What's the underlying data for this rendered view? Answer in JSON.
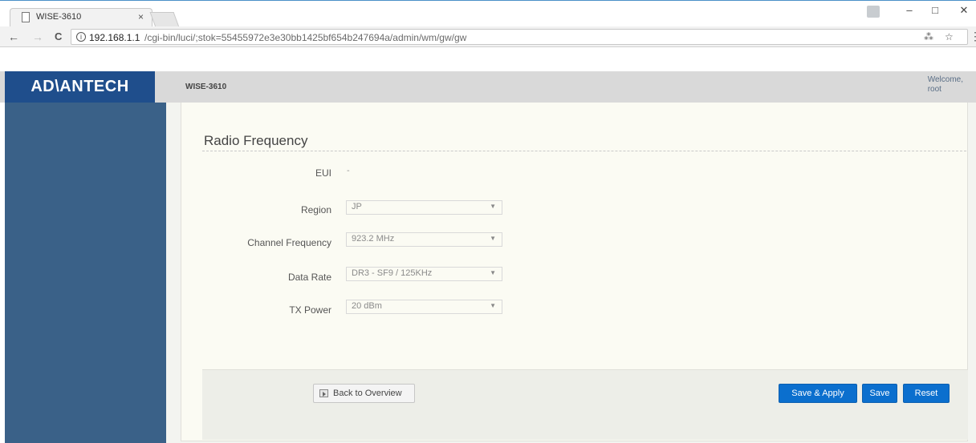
{
  "browser": {
    "tab_title": "WISE-3610",
    "tab_close": "×",
    "url_host": "192.168.1.1",
    "url_path": "/cgi-bin/luci/;stok=55455972e3e30bb1425bf654b247694a/admin/wm/gw/gw",
    "window_controls": {
      "minimize": "–",
      "maximize": "□",
      "close": "✕"
    },
    "nav": {
      "back": "←",
      "forward": "→",
      "reload": "C",
      "info": "i",
      "translate": "⁂",
      "bookmark": "☆",
      "menu": "⋮"
    }
  },
  "header": {
    "logo": "AD\\ANTECH",
    "hostname": "WISE-3610",
    "welcome": "Welcome,",
    "user": "root"
  },
  "colors": {
    "brand": "#1f4e8c",
    "sidebar": "#3a6188",
    "primary_button": "#0b6fce"
  },
  "form": {
    "title": "Radio Frequency",
    "eui": {
      "label": "EUI",
      "value": "-"
    },
    "region": {
      "label": "Region",
      "value": "JP"
    },
    "channel_frequency": {
      "label": "Channel Frequency",
      "value": "923.2 MHz"
    },
    "data_rate": {
      "label": "Data Rate",
      "value": "DR3 - SF9 / 125KHz"
    },
    "tx_power": {
      "label": "TX Power",
      "value": "20 dBm"
    },
    "select_arrow": "▼"
  },
  "footer": {
    "back_label": "Back to Overview",
    "save_apply_label": "Save & Apply",
    "save_label": "Save",
    "reset_label": "Reset"
  }
}
